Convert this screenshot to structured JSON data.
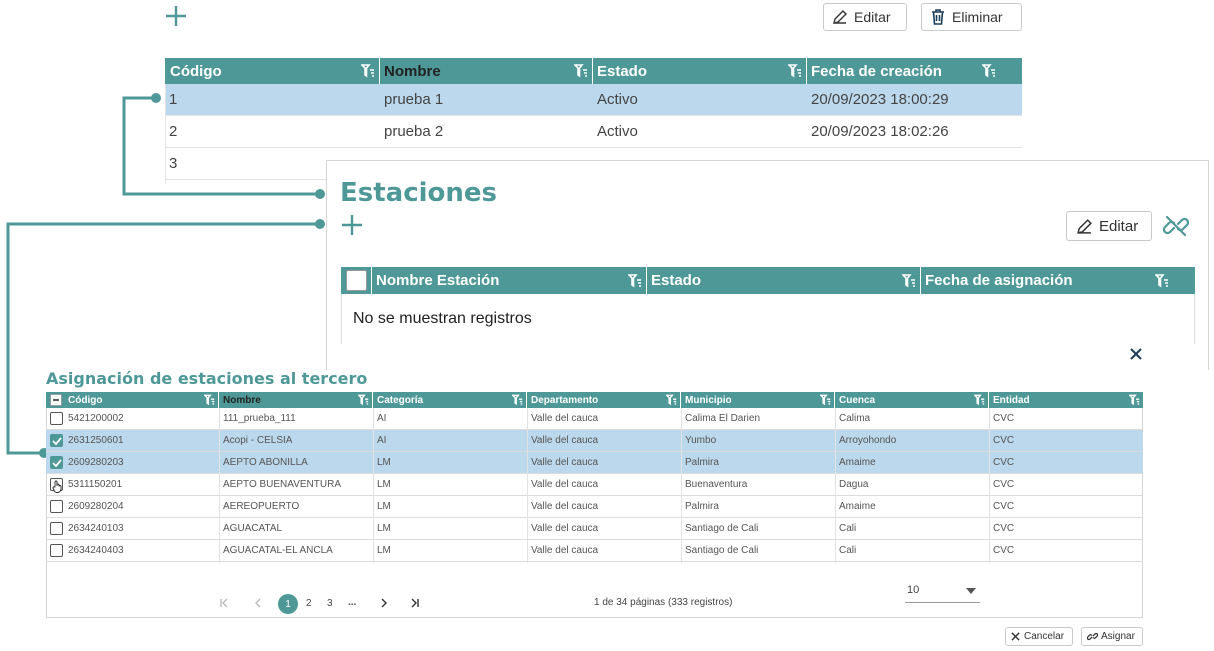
{
  "top": {
    "edit_label": "Editar",
    "delete_label": "Eliminar",
    "columns": [
      "Código",
      "Nombre",
      "Estado",
      "Fecha de creación"
    ],
    "rows": [
      {
        "codigo": "1",
        "nombre": "prueba 1",
        "estado": "Activo",
        "fecha": "20/09/2023 18:00:29",
        "selected": true
      },
      {
        "codigo": "2",
        "nombre": "prueba 2",
        "estado": "Activo",
        "fecha": "20/09/2023 18:02:26",
        "selected": false
      },
      {
        "codigo": "3",
        "nombre": "",
        "estado": "",
        "fecha": "",
        "selected": false
      }
    ]
  },
  "stations": {
    "title": "Estaciones",
    "edit_label": "Editar",
    "columns": [
      "Nombre Estación",
      "Estado",
      "Fecha de asignación"
    ],
    "empty_text": "No se muestran registros"
  },
  "modal": {
    "title": "Asignación de estaciones al tercero",
    "columns": [
      "Código",
      "Nombre",
      "Categoría",
      "Departamento",
      "Municipio",
      "Cuenca",
      "Entidad"
    ],
    "rows": [
      {
        "checked": false,
        "cells": [
          "5421200002",
          "111_prueba_111",
          "AI",
          "Valle del cauca",
          "Calima El Darien",
          "Calima",
          "CVC"
        ]
      },
      {
        "checked": true,
        "cells": [
          "2631250601",
          "Acopi - CELSIA",
          "AI",
          "Valle del cauca",
          "Yumbo",
          "Arroyohondo",
          "CVC"
        ]
      },
      {
        "checked": true,
        "cells": [
          "2609280203",
          "AEPTO ABONILLA",
          "LM",
          "Valle del cauca",
          "Palmira",
          "Amaime",
          "CVC"
        ]
      },
      {
        "checked": false,
        "cells": [
          "5311150201",
          "AEPTO BUENAVENTURA",
          "LM",
          "Valle del cauca",
          "Buenaventura",
          "Dagua",
          "CVC"
        ]
      },
      {
        "checked": false,
        "cells": [
          "2609280204",
          "AEREOPUERTO",
          "LM",
          "Valle del cauca",
          "Palmira",
          "Amaime",
          "CVC"
        ]
      },
      {
        "checked": false,
        "cells": [
          "2634240103",
          "AGUACATAL",
          "LM",
          "Valle del cauca",
          "Santiago de Cali",
          "Cali",
          "CVC"
        ]
      },
      {
        "checked": false,
        "cells": [
          "2634240403",
          "AGUACATAL-EL ANCLA",
          "LM",
          "Valle del cauca",
          "Santiago de Cali",
          "Cali",
          "CVC"
        ]
      }
    ],
    "pager": {
      "pages": [
        "1",
        "2",
        "3"
      ],
      "ellipsis": "...",
      "current": "1",
      "info": "1 de 34 páginas (333 registros)",
      "page_size": "10"
    },
    "cancel_label": "Cancelar",
    "assign_label": "Asignar",
    "close_glyph": "×"
  },
  "colors": {
    "accent": "#4f9898",
    "selected_row": "#bcd8ec",
    "title": "#4f9898"
  }
}
